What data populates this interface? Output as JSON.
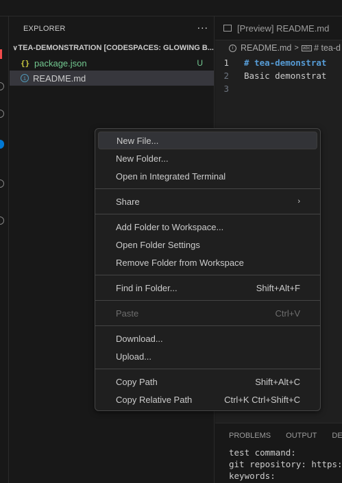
{
  "sidebar": {
    "title": "EXPLORER",
    "more_icon": "···",
    "folder": {
      "chevron": "∨",
      "label": "TEA-DEMONSTRATION [CODESPACES: GLOWING B..."
    },
    "files": [
      {
        "icon": "{}",
        "name": "package.json",
        "badge": "U"
      },
      {
        "icon": "i",
        "name": "README.md"
      }
    ]
  },
  "editor": {
    "tab_label": "[Preview] README.md",
    "breadcrumb": {
      "file": "README.md",
      "separator": ">",
      "symbol": "# tea-d"
    },
    "lines": [
      {
        "number": "1",
        "text": "# tea-demonstrat"
      },
      {
        "number": "2",
        "text": "Basic demonstrat"
      },
      {
        "number": "3",
        "text": ""
      }
    ]
  },
  "panel": {
    "tabs": [
      "PROBLEMS",
      "OUTPUT",
      "DEBU"
    ],
    "lines": [
      "test command:",
      "git repository: https:/",
      "keywords:"
    ]
  },
  "context_menu": {
    "new_file": "New File...",
    "new_folder": "New Folder...",
    "open_terminal": "Open in Integrated Terminal",
    "share": "Share",
    "submenu_arrow": "›",
    "add_folder": "Add Folder to Workspace...",
    "open_folder_settings": "Open Folder Settings",
    "remove_folder": "Remove Folder from Workspace",
    "find_in_folder": "Find in Folder...",
    "find_in_folder_kb": "Shift+Alt+F",
    "paste": "Paste",
    "paste_kb": "Ctrl+V",
    "download": "Download...",
    "upload": "Upload...",
    "copy_path": "Copy Path",
    "copy_path_kb": "Shift+Alt+C",
    "copy_relative_path": "Copy Relative Path",
    "copy_relative_path_kb": "Ctrl+K Ctrl+Shift+C"
  },
  "colors": {
    "accent": "#0078d4",
    "git_untracked": "#73c991",
    "json_icon": "#cbcb41",
    "markdown_heading": "#569cd6"
  }
}
